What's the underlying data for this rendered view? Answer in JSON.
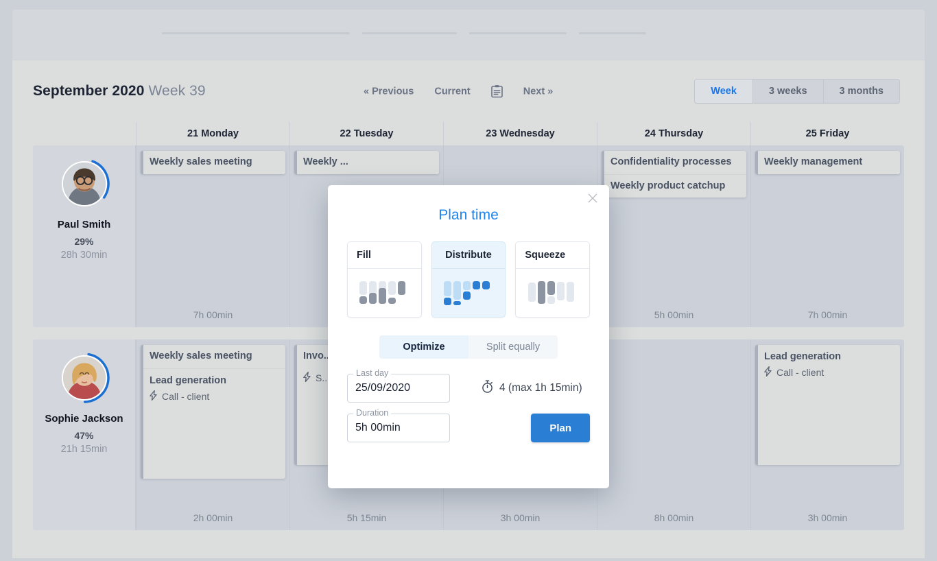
{
  "header": {
    "month_year": "September 2020",
    "week_label": "Week 39",
    "nav": {
      "previous": "« Previous",
      "current": "Current",
      "next": "Next »",
      "calendar_icon": "calendar-icon"
    },
    "views": [
      {
        "label": "Week",
        "active": true
      },
      {
        "label": "3 weeks",
        "active": false
      },
      {
        "label": "3 months",
        "active": false
      }
    ],
    "accent_color": "#1976ed"
  },
  "calendar": {
    "days": [
      "21 Monday",
      "22 Tuesday",
      "23 Wednesday",
      "24 Thursday",
      "25 Friday"
    ],
    "rows": [
      {
        "person": {
          "name": "Paul Smith",
          "percent": "29%",
          "time": "28h 30min",
          "ring_pct": 29
        },
        "cells": [
          {
            "total": "7h 00min",
            "events": [
              {
                "title": "Weekly sales meeting"
              }
            ]
          },
          {
            "total": "",
            "events": [
              {
                "title": "Weekly ..."
              }
            ]
          },
          {
            "total": "",
            "events": []
          },
          {
            "total": "5h 00min",
            "events": [
              {
                "title": "Confidentiality processes"
              },
              {
                "title": "Weekly product catchup"
              }
            ]
          },
          {
            "total": "7h 00min",
            "events": [
              {
                "title": "Weekly management"
              }
            ]
          }
        ]
      },
      {
        "person": {
          "name": "Sophie Jackson",
          "percent": "47%",
          "time": "21h 15min",
          "ring_pct": 47
        },
        "cells": [
          {
            "total": "2h 00min",
            "events": [
              {
                "title": "Weekly sales meeting",
                "task": "Lead generation",
                "sub": "Call - client",
                "sub_icon": "bolt-icon",
                "tall": true
              }
            ]
          },
          {
            "total": "5h 15min",
            "events": [
              {
                "title": "Invo...",
                "sub": "S... b...",
                "sub_icon": "bolt-icon"
              }
            ]
          },
          {
            "total": "3h 00min",
            "events": [
              {
                "title": "",
                "tall": true
              }
            ]
          },
          {
            "total": "8h 00min",
            "events": []
          },
          {
            "total": "3h 00min",
            "events": [
              {
                "title": "",
                "task": "Lead generation",
                "sub": "Call - client",
                "sub_icon": "bolt-icon",
                "tall": true
              }
            ]
          }
        ]
      }
    ]
  },
  "modal": {
    "title": "Plan time",
    "close_icon": "close-icon",
    "modes": [
      {
        "label": "Fill",
        "selected": false,
        "icon": "fill-chart-icon"
      },
      {
        "label": "Distribute",
        "selected": true,
        "icon": "distribute-chart-icon"
      },
      {
        "label": "Squeeze",
        "selected": false,
        "icon": "squeeze-chart-icon"
      }
    ],
    "strategies": [
      {
        "label": "Optimize",
        "selected": true
      },
      {
        "label": "Split equally",
        "selected": false
      }
    ],
    "last_day": {
      "label": "Last day",
      "value": "25/09/2020"
    },
    "duration": {
      "label": "Duration",
      "value": "5h 00min"
    },
    "meta": {
      "icon": "stopwatch-icon",
      "text": "4 (max 1h 15min)"
    },
    "plan_button": "Plan",
    "title_color": "#1e84ee",
    "button_color": "#2a7fd4"
  }
}
